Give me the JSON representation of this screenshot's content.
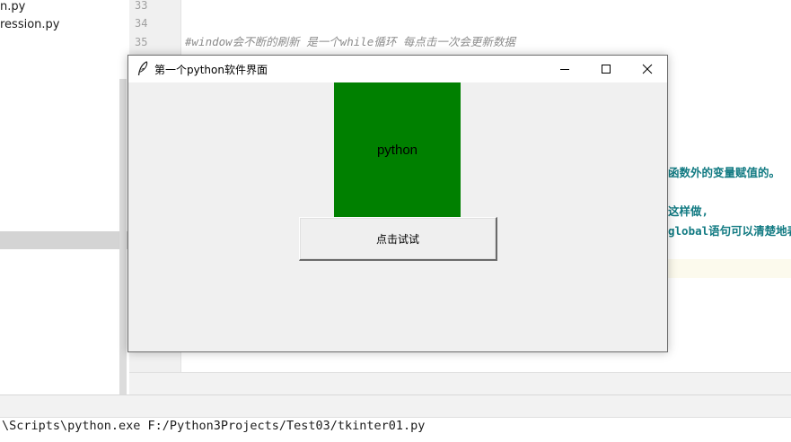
{
  "project": {
    "files": [
      "n.py",
      "ression.py"
    ]
  },
  "editor": {
    "line_numbers": [
      "33",
      "34",
      "35"
    ],
    "comment_line": "#window会不断的刷新 是一个while循环 每点击一次会更新数据",
    "fragments": [
      "函数外的变量赋值的。",
      "这样做,",
      "global语句可以清楚地表"
    ]
  },
  "console": {
    "command": "\\Scripts\\python.exe F:/Python3Projects/Test03/tkinter01.py"
  },
  "tk_window": {
    "title": "第一个python软件界面",
    "label_text": "python",
    "label_bg": "#008000",
    "button_text": "点击试试",
    "controls": [
      "minimize-icon",
      "maximize-icon",
      "close-icon"
    ]
  }
}
